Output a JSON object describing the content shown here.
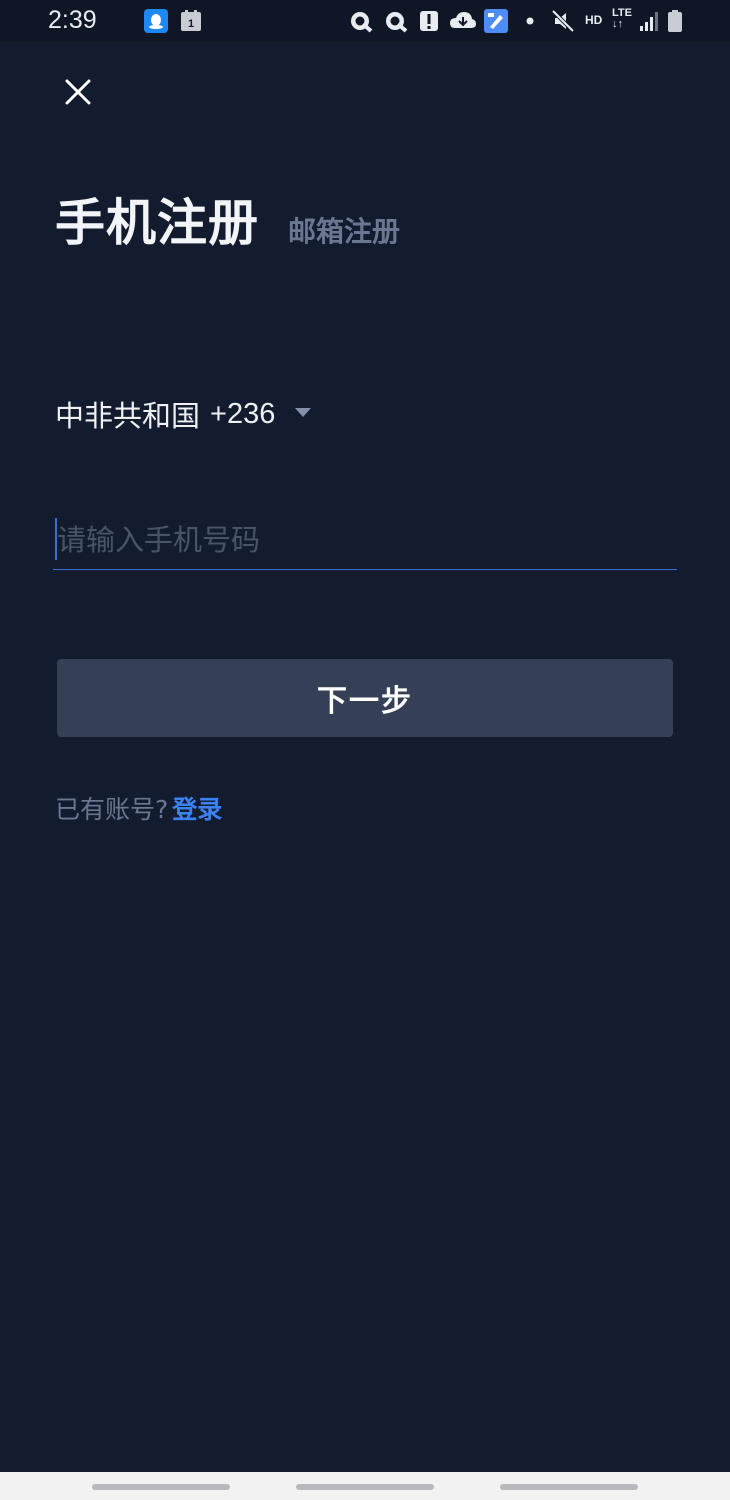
{
  "status_bar": {
    "time": "2:39",
    "notification_badge": "1",
    "hd_label": "HD",
    "lte_label": "LTE",
    "icons": [
      "qq-icon",
      "calendar-icon",
      "quark-icon",
      "quark-icon",
      "alert-icon",
      "cloud-icon",
      "paint-app-icon",
      "dot-icon",
      "mute-icon",
      "signal-icon",
      "battery-icon"
    ]
  },
  "header": {
    "close_icon": "close-icon",
    "title": "手机注册",
    "alt_tab": "邮箱注册"
  },
  "country": {
    "name": "中非共和国",
    "code": "+236"
  },
  "phone": {
    "placeholder": "请输入手机号码",
    "value": ""
  },
  "next_button": {
    "label": "下一步"
  },
  "login": {
    "prompt": "已有账号?",
    "link": "登录"
  },
  "colors": {
    "background": "#131b2f",
    "accent": "#3b82f6",
    "button": "#353f56",
    "muted_text": "#6b7690"
  }
}
